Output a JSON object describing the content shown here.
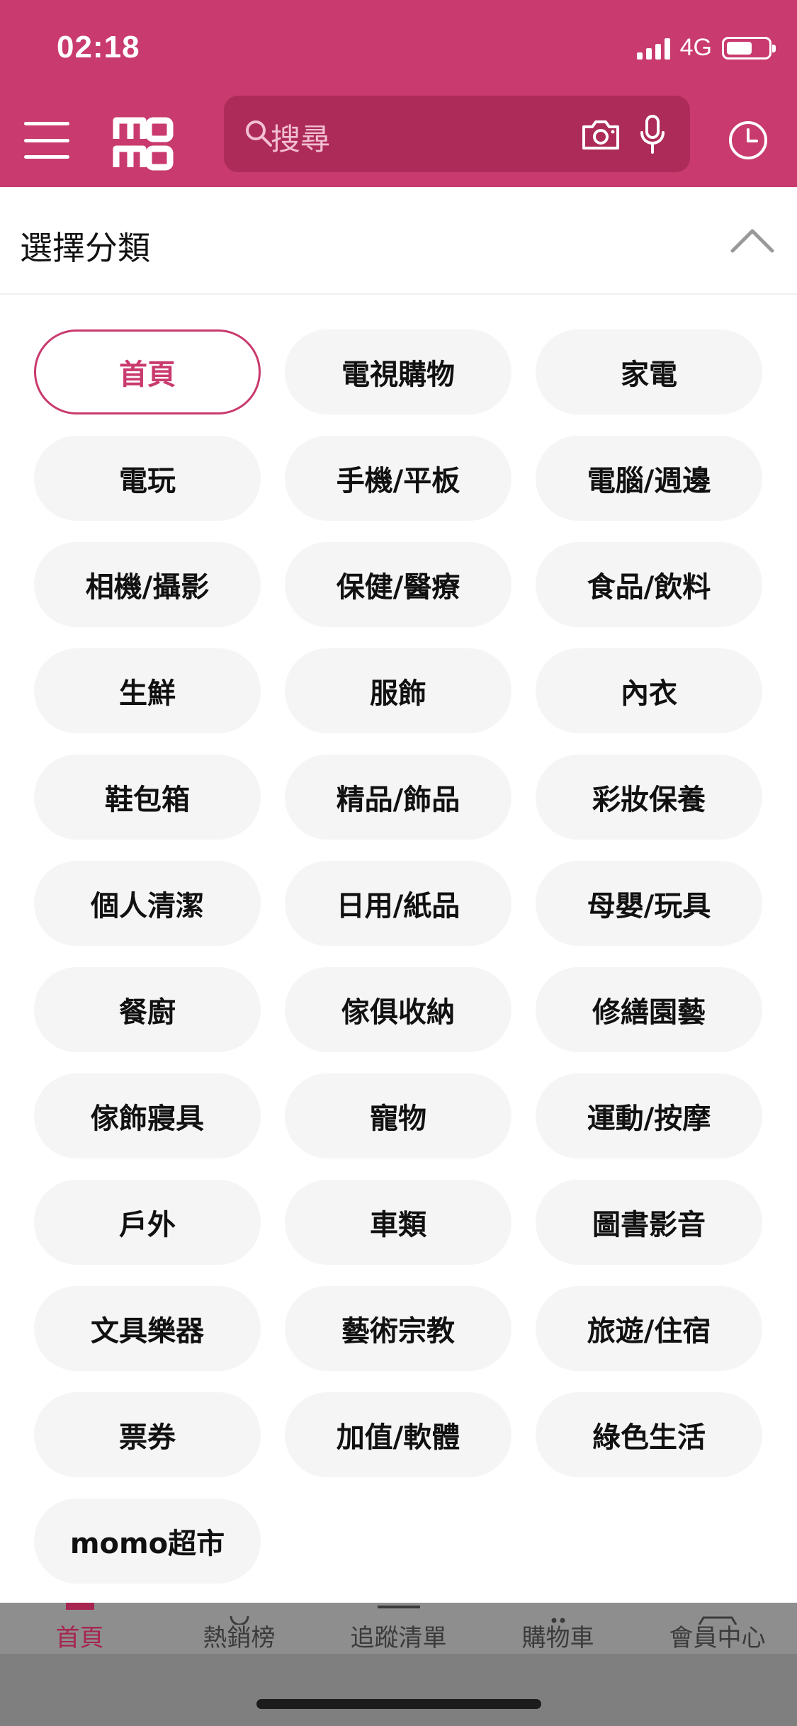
{
  "status": {
    "time": "02:18",
    "network": "4G"
  },
  "search": {
    "placeholder": "搜尋"
  },
  "section": {
    "title": "選擇分類"
  },
  "categories": [
    "首頁",
    "電視購物",
    "家電",
    "電玩",
    "手機/平板",
    "電腦/週邊",
    "相機/攝影",
    "保健/醫療",
    "食品/飲料",
    "生鮮",
    "服飾",
    "內衣",
    "鞋包箱",
    "精品/飾品",
    "彩妝保養",
    "個人清潔",
    "日用/紙品",
    "母嬰/玩具",
    "餐廚",
    "傢俱收納",
    "修繕園藝",
    "傢飾寢具",
    "寵物",
    "運動/按摩",
    "戶外",
    "車類",
    "圖書影音",
    "文具樂器",
    "藝術宗教",
    "旅遊/住宿",
    "票券",
    "加值/軟體",
    "綠色生活",
    "momo超市"
  ],
  "active_category": "首頁",
  "tabs": [
    "首頁",
    "熱銷榜",
    "追蹤清單",
    "購物車",
    "會員中心"
  ],
  "colors": {
    "brand": "#c93a6e",
    "active_tab": "#a6264f"
  }
}
